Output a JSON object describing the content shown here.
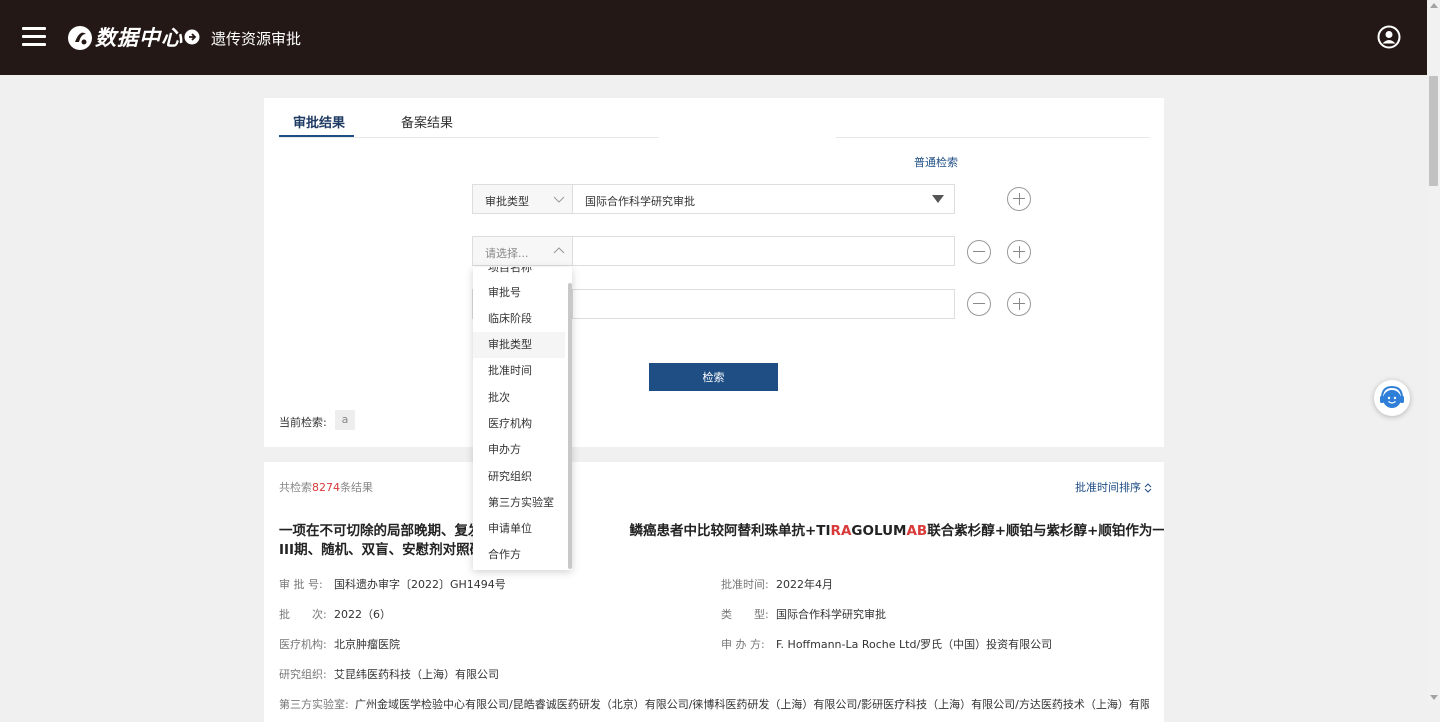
{
  "header": {
    "logo_text": "数据中心",
    "breadcrumb": "遗传资源审批"
  },
  "tabs": [
    {
      "label": "审批结果",
      "active": true
    },
    {
      "label": "备案结果",
      "active": false
    }
  ],
  "simple_search_link": "普通检索",
  "search_rows": [
    {
      "field": "审批类型",
      "value": "国际合作科学研究审批"
    },
    {
      "field": "请选择...",
      "value": ""
    },
    {
      "field": "",
      "value": ""
    }
  ],
  "search_button": "检索",
  "current_search": {
    "label": "当前检索:",
    "tag": "a"
  },
  "dropdown": {
    "partial_item": "项目名称",
    "items": [
      "审批号",
      "临床阶段",
      "审批类型",
      "批准时间",
      "批次",
      "医疗机构",
      "申办方",
      "研究组织",
      "第三方实验室",
      "申请单位",
      "合作方"
    ],
    "hovered": "审批类型"
  },
  "results": {
    "count_prefix": "共检索",
    "count": "8274",
    "count_suffix": "条结果",
    "sort_label": "批准时间排序",
    "item": {
      "title_part1": "一项在不可切除的局部晚期、复发",
      "title_part2": "鳞癌患者中比较阿替利珠单抗+TI",
      "title_hl1": "RA",
      "title_part3": "GOLUM",
      "title_hl2": "AB",
      "title_part4": "联合紫杉醇+顺铂与紫杉醇+顺铂作为一线治疗的",
      "title_line2": "III期、随机、双盲、安慰剂对照研",
      "fields": {
        "approval_no": {
          "k": "审 批 号:",
          "v": "国科遗办审字〔2022〕GH1494号"
        },
        "approval_time": {
          "k": "批准时间:",
          "v": "2022年4月"
        },
        "batch": {
          "k": "批　　次:",
          "v": "2022（6）"
        },
        "type": {
          "k": "类　　型:",
          "v": "国际合作科学研究审批"
        },
        "institution": {
          "k": "医疗机构:",
          "v": "北京肿瘤医院"
        },
        "sponsor": {
          "k": "申 办 方:",
          "v": "F. Hoffmann-La Roche Ltd/罗氏（中国）投资有限公司"
        },
        "research_org": {
          "k": "研究组织:",
          "v": "艾昆纬医药科技（上海）有限公司"
        },
        "third_party_lab": {
          "k": "第三方实验室:",
          "v": "广州金域医学检验中心有限公司/昆皓睿诚医药研发（北京）有限公司/徕博科医药研发（上海）有限公司/影研医疗科技（上海）有限公司/方达医药技术（上海）有限公"
        }
      }
    }
  },
  "colors": {
    "header_bg": "#231815",
    "accent": "#1f4e85",
    "highlight": "#d83a3a"
  }
}
